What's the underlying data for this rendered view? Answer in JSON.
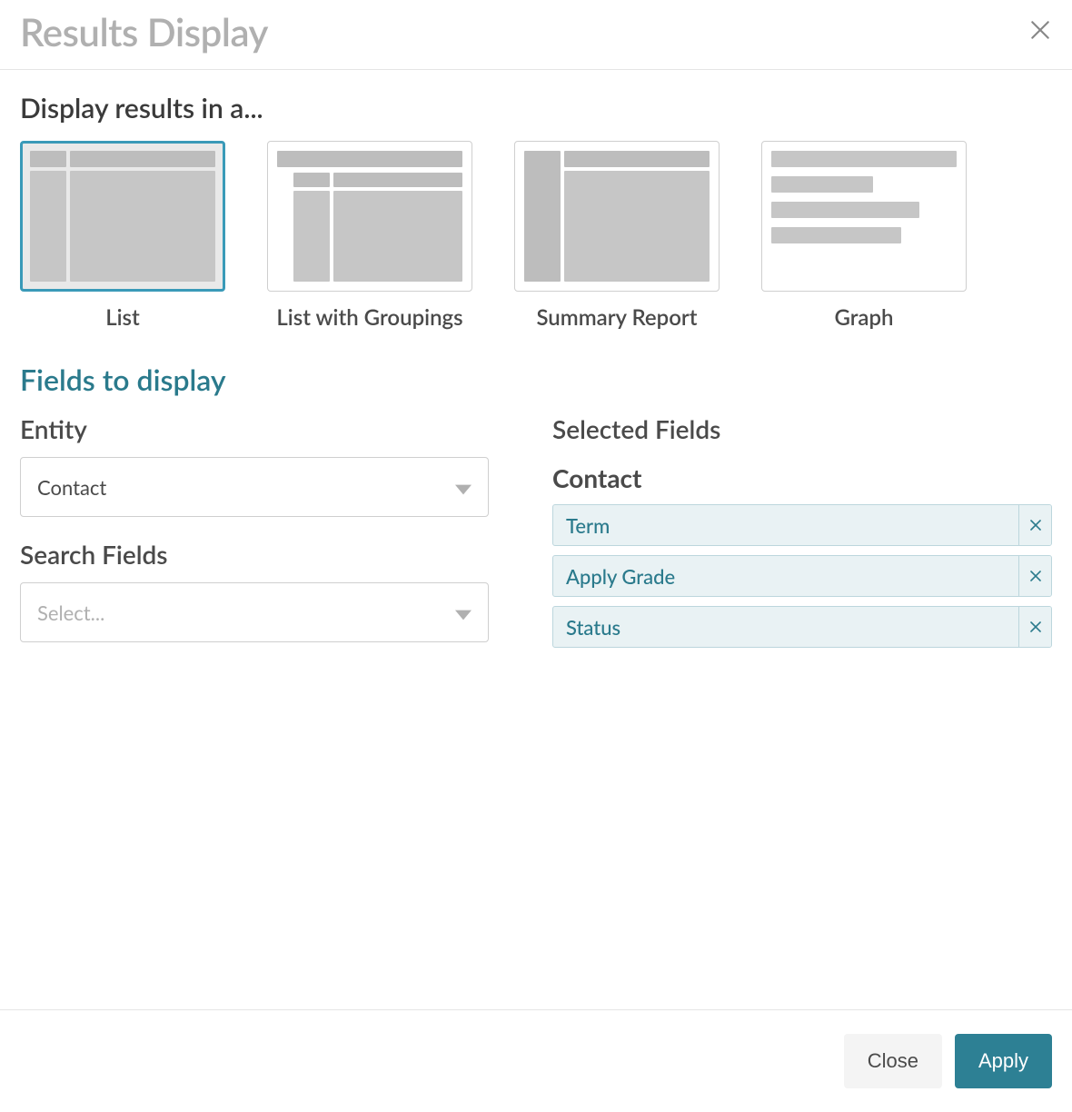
{
  "header": {
    "title": "Results Display"
  },
  "display": {
    "heading": "Display results in a...",
    "options": {
      "list": "List",
      "list_groupings": "List with Groupings",
      "summary": "Summary Report",
      "graph": "Graph"
    },
    "selected": "list"
  },
  "fields_section": {
    "heading": "Fields to display",
    "entity_label": "Entity",
    "entity_value": "Contact",
    "search_fields_label": "Search Fields",
    "search_fields_placeholder": "Select...",
    "selected_fields_label": "Selected Fields",
    "selected_group": "Contact",
    "selected_items": {
      "0": "Term",
      "1": "Apply Grade",
      "2": "Status"
    }
  },
  "footer": {
    "close": "Close",
    "apply": "Apply"
  }
}
